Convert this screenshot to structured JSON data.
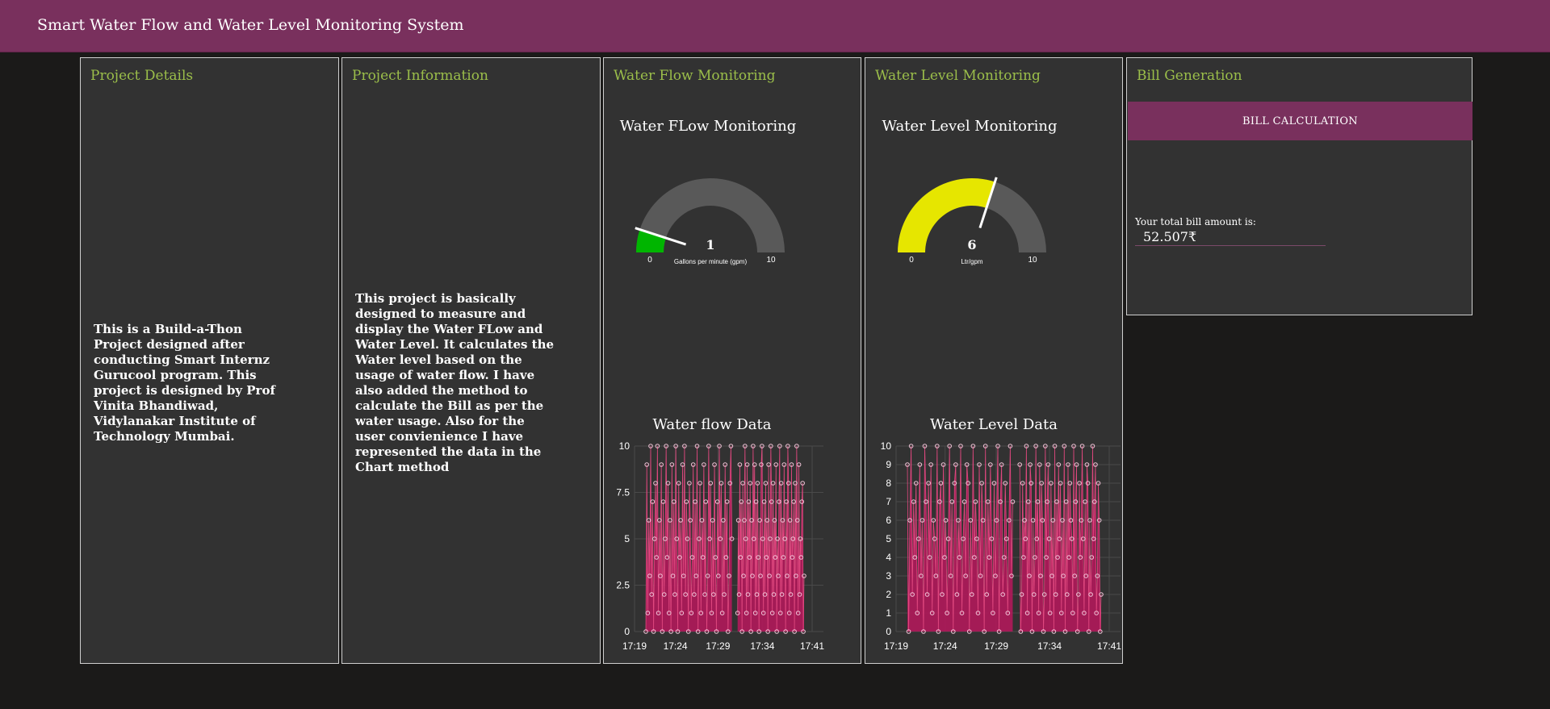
{
  "header": {
    "title": "Smart Water Flow and Water Level Monitoring System"
  },
  "cards": {
    "project_details": {
      "title": "Project Details",
      "body": "This is a Build-a-Thon Project designed after conducting Smart Internz Gurucool program. This project is designed by Prof Vinita Bhandiwad, Vidylanakar Institute of Technology Mumbai."
    },
    "project_information": {
      "title": "Project Information",
      "body": "This project is basically designed to measure and display the Water FLow and Water Level. It calculates the Water level based on the usage of water flow. I have also added the method to calculate the Bill as per the water usage. Also for the user convienience I have represented the data in the Chart method"
    },
    "water_flow": {
      "title": "Water Flow Monitoring",
      "gauge_title": "Water FLow Monitoring",
      "gauge": {
        "value": 1,
        "min": 0,
        "max": 10,
        "unit": "Gallons per minute (gpm)",
        "color": "#00b500",
        "track_color": "#595959"
      },
      "chart_title": "Water flow Data"
    },
    "water_level": {
      "title": "Water Level Monitoring",
      "gauge_title": "Water Level Monitoring",
      "gauge": {
        "value": 6,
        "min": 0,
        "max": 10,
        "unit": "Ltr/gpm",
        "color": "#e6e600",
        "track_color": "#595959"
      },
      "chart_title": "Water Level Data"
    },
    "bill": {
      "title": "Bill Generation",
      "button_label": "BILL CALCULATION",
      "label": "Your total bill amount is:",
      "value": "52.507₹"
    }
  },
  "colors": {
    "accent": "#79305d",
    "card_title": "#9bbe4a",
    "series": "#b0185a",
    "marker": "#f2c4d8"
  },
  "chart_data": [
    {
      "type": "line",
      "title": "Water flow Data",
      "xlabel": "",
      "ylabel": "",
      "x_ticks": [
        "17:19",
        "17:24",
        "17:29",
        "17:34",
        "17:41"
      ],
      "y_ticks": [
        "0",
        "2.5",
        "5",
        "7.5",
        "10"
      ],
      "ylim": [
        0,
        10
      ],
      "grid": true,
      "gaps": [
        [
          0.55,
          0.58
        ]
      ],
      "series": [
        {
          "values": [
            0,
            9,
            1,
            6,
            3,
            10,
            2,
            7,
            0,
            5,
            8,
            4,
            10,
            1,
            6,
            3,
            9,
            0,
            7,
            2,
            5,
            10,
            4,
            8,
            1,
            6,
            0,
            9,
            3,
            7,
            2,
            10,
            5,
            0,
            8,
            4,
            6,
            1,
            9,
            3,
            10,
            2,
            7,
            5,
            0,
            8,
            6,
            1,
            4,
            9,
            2,
            7,
            3,
            10,
            0,
            5,
            8,
            1,
            6,
            4,
            9,
            2,
            7,
            0,
            3,
            10,
            5,
            8,
            1,
            6,
            2,
            9,
            4,
            0,
            7,
            3,
            10,
            5,
            8,
            1,
            6,
            2,
            9,
            4,
            7,
            0,
            3,
            8,
            10,
            5,
            1,
            6,
            2,
            9,
            4,
            7,
            0,
            8,
            3,
            6,
            10,
            5,
            1,
            9,
            2,
            7,
            4,
            8,
            0,
            6,
            3,
            10,
            5,
            9,
            1,
            7,
            2,
            8,
            4,
            0,
            6,
            3,
            9,
            10,
            5,
            1,
            7,
            2,
            8,
            4,
            6,
            0,
            9,
            3,
            5,
            10,
            7,
            1,
            8,
            2,
            6,
            4,
            9,
            0,
            5,
            3,
            7,
            10,
            1,
            8,
            2,
            6,
            4,
            9,
            5,
            0,
            7,
            3,
            10,
            8,
            1,
            6,
            2,
            9,
            4,
            5,
            7,
            0,
            8,
            3,
            10,
            6,
            1,
            9,
            2,
            5,
            4,
            7,
            8,
            0,
            3
          ]
        }
      ]
    },
    {
      "type": "line",
      "title": "Water Level Data",
      "xlabel": "",
      "ylabel": "",
      "x_ticks": [
        "17:19",
        "17:24",
        "17:29",
        "17:34",
        "17:41"
      ],
      "y_ticks": [
        "0",
        "1",
        "2",
        "3",
        "4",
        "5",
        "6",
        "7",
        "8",
        "9",
        "10"
      ],
      "ylim": [
        0,
        10
      ],
      "grid": true,
      "gaps": [
        [
          0.55,
          0.58
        ]
      ],
      "series": [
        {
          "values": [
            9,
            0,
            6,
            10,
            2,
            7,
            4,
            8,
            1,
            5,
            9,
            3,
            6,
            0,
            10,
            7,
            2,
            8,
            4,
            9,
            1,
            6,
            5,
            3,
            10,
            0,
            7,
            8,
            2,
            9,
            4,
            6,
            1,
            5,
            10,
            3,
            7,
            0,
            8,
            9,
            2,
            6,
            4,
            10,
            1,
            5,
            7,
            3,
            9,
            8,
            0,
            6,
            2,
            10,
            4,
            7,
            5,
            1,
            9,
            3,
            8,
            6,
            0,
            10,
            2,
            7,
            4,
            9,
            5,
            1,
            8,
            3,
            6,
            10,
            0,
            7,
            9,
            2,
            4,
            8,
            5,
            1,
            6,
            10,
            3,
            7,
            9,
            0,
            2,
            8,
            4,
            6,
            5,
            10,
            1,
            7,
            3,
            9,
            8,
            0,
            6,
            2,
            4,
            10,
            5,
            7,
            1,
            9,
            3,
            8,
            6,
            0,
            2,
            10,
            4,
            7,
            9,
            5,
            1,
            8,
            3,
            6,
            0,
            10,
            2,
            7,
            4,
            9,
            5,
            8,
            1,
            6,
            3,
            10,
            0,
            7,
            2,
            9,
            4,
            8,
            6,
            5,
            1,
            10,
            3,
            7,
            9,
            0,
            2,
            8,
            4,
            6,
            10,
            5,
            1,
            7,
            3,
            9,
            8,
            0,
            6,
            2,
            4,
            10,
            5,
            7,
            9,
            1,
            3,
            8,
            6,
            0,
            2
          ]
        }
      ]
    }
  ]
}
